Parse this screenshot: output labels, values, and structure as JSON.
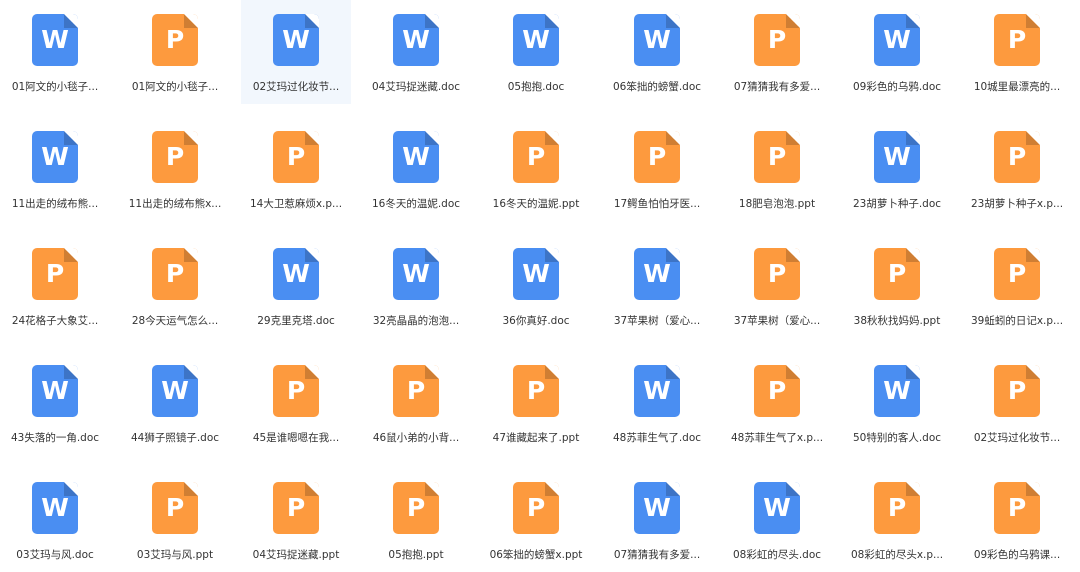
{
  "colors": {
    "word_icon": "#4a8ef2",
    "ppt_icon": "#fd9a3e",
    "selected_bg": "#f2f7fd"
  },
  "icon_letters": {
    "doc": "W",
    "ppt": "P"
  },
  "files": [
    {
      "type": "doc",
      "name": "01阿文的小毯子...",
      "selected": false
    },
    {
      "type": "ppt",
      "name": "01阿文的小毯子...",
      "selected": false
    },
    {
      "type": "doc",
      "name": "02艾玛过化妆节...",
      "selected": true
    },
    {
      "type": "doc",
      "name": "04艾玛捉迷藏.doc",
      "selected": false
    },
    {
      "type": "doc",
      "name": "05抱抱.doc",
      "selected": false
    },
    {
      "type": "doc",
      "name": "06笨拙的螃蟹.doc",
      "selected": false
    },
    {
      "type": "ppt",
      "name": "07猜猜我有多爱...",
      "selected": false
    },
    {
      "type": "doc",
      "name": "09彩色的乌鸦.doc",
      "selected": false
    },
    {
      "type": "ppt",
      "name": "10城里最漂亮的...",
      "selected": false
    },
    {
      "type": "doc",
      "name": "11出走的绒布熊...",
      "selected": false
    },
    {
      "type": "ppt",
      "name": "11出走的绒布熊x...",
      "selected": false
    },
    {
      "type": "ppt",
      "name": "14大卫惹麻烦x.p...",
      "selected": false
    },
    {
      "type": "doc",
      "name": "16冬天的温妮.doc",
      "selected": false
    },
    {
      "type": "ppt",
      "name": "16冬天的温妮.ppt",
      "selected": false
    },
    {
      "type": "ppt",
      "name": "17鳄鱼怕怕牙医...",
      "selected": false
    },
    {
      "type": "ppt",
      "name": "18肥皂泡泡.ppt",
      "selected": false
    },
    {
      "type": "doc",
      "name": "23胡萝卜种子.doc",
      "selected": false
    },
    {
      "type": "ppt",
      "name": "23胡萝卜种子x.p...",
      "selected": false
    },
    {
      "type": "ppt",
      "name": "24花格子大象艾...",
      "selected": false
    },
    {
      "type": "ppt",
      "name": "28今天运气怎么...",
      "selected": false
    },
    {
      "type": "doc",
      "name": "29克里克塔.doc",
      "selected": false
    },
    {
      "type": "doc",
      "name": "32亮晶晶的泡泡...",
      "selected": false
    },
    {
      "type": "doc",
      "name": "36你真好.doc",
      "selected": false
    },
    {
      "type": "doc",
      "name": "37苹果树（爱心...",
      "selected": false
    },
    {
      "type": "ppt",
      "name": "37苹果树（爱心...",
      "selected": false
    },
    {
      "type": "ppt",
      "name": "38秋秋找妈妈.ppt",
      "selected": false
    },
    {
      "type": "ppt",
      "name": "39蚯蚓的日记x.p...",
      "selected": false
    },
    {
      "type": "doc",
      "name": "43失落的一角.doc",
      "selected": false
    },
    {
      "type": "doc",
      "name": "44狮子照镜子.doc",
      "selected": false
    },
    {
      "type": "ppt",
      "name": "45是谁嗯嗯在我...",
      "selected": false
    },
    {
      "type": "ppt",
      "name": "46鼠小弟的小背...",
      "selected": false
    },
    {
      "type": "ppt",
      "name": "47谁藏起来了.ppt",
      "selected": false
    },
    {
      "type": "doc",
      "name": "48苏菲生气了.doc",
      "selected": false
    },
    {
      "type": "ppt",
      "name": "48苏菲生气了x.p...",
      "selected": false
    },
    {
      "type": "doc",
      "name": "50特别的客人.doc",
      "selected": false
    },
    {
      "type": "ppt",
      "name": "02艾玛过化妆节...",
      "selected": false
    },
    {
      "type": "doc",
      "name": "03艾玛与风.doc",
      "selected": false
    },
    {
      "type": "ppt",
      "name": "03艾玛与风.ppt",
      "selected": false
    },
    {
      "type": "ppt",
      "name": "04艾玛捉迷藏.ppt",
      "selected": false
    },
    {
      "type": "ppt",
      "name": "05抱抱.ppt",
      "selected": false
    },
    {
      "type": "ppt",
      "name": "06笨拙的螃蟹x.ppt",
      "selected": false
    },
    {
      "type": "doc",
      "name": "07猜猜我有多爱...",
      "selected": false
    },
    {
      "type": "doc",
      "name": "08彩虹的尽头.doc",
      "selected": false
    },
    {
      "type": "ppt",
      "name": "08彩虹的尽头x.p...",
      "selected": false
    },
    {
      "type": "ppt",
      "name": "09彩色的乌鸦课...",
      "selected": false
    }
  ]
}
